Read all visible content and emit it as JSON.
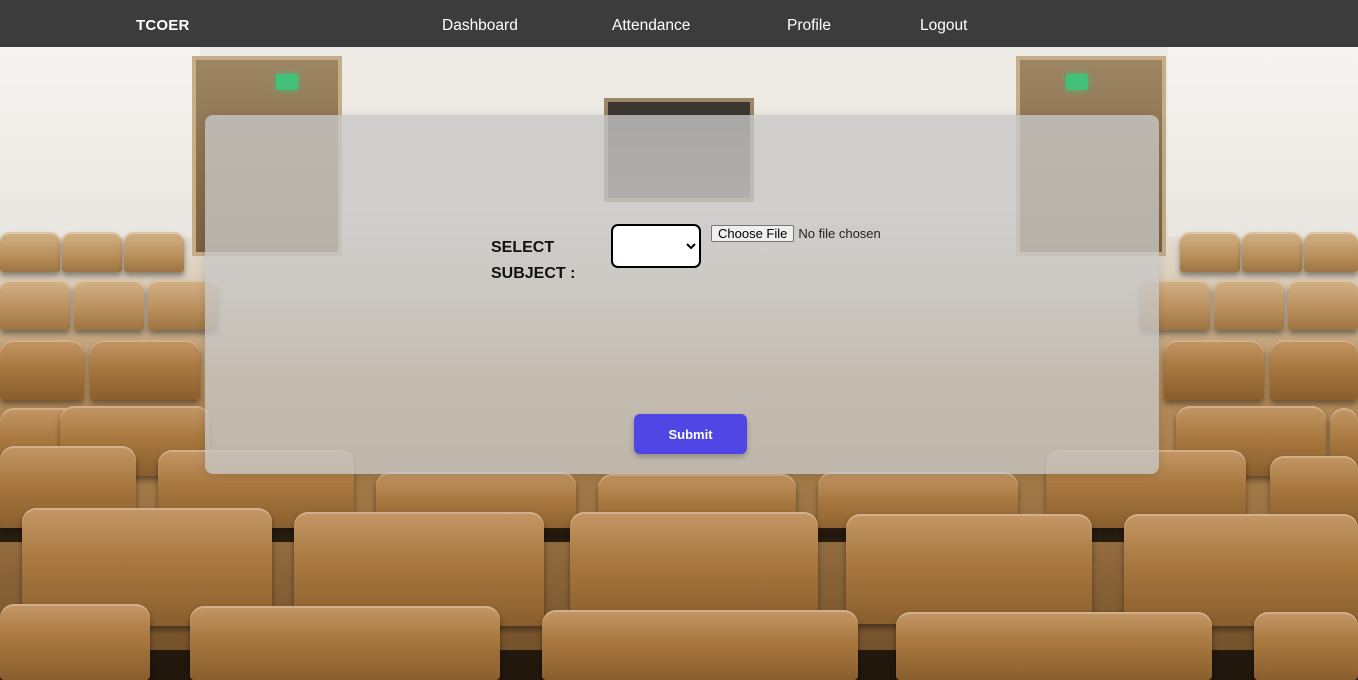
{
  "navbar": {
    "brand": "TCOER",
    "links": [
      {
        "label": "Dashboard"
      },
      {
        "label": "Attendance"
      },
      {
        "label": "Profile"
      },
      {
        "label": "Logout"
      }
    ]
  },
  "form": {
    "subject_label": "SELECT SUBJECT :",
    "subject_select_value": "",
    "file_button_label": "Choose File",
    "file_status": "No file chosen",
    "submit_label": "Submit"
  },
  "colors": {
    "navbar_bg": "#3d3c3c",
    "panel_bg": "#c8c8c8",
    "submit_bg": "#4f46e5",
    "nav_text": "#ffffff"
  },
  "background": {
    "scene": "lecture-hall-chairs"
  }
}
